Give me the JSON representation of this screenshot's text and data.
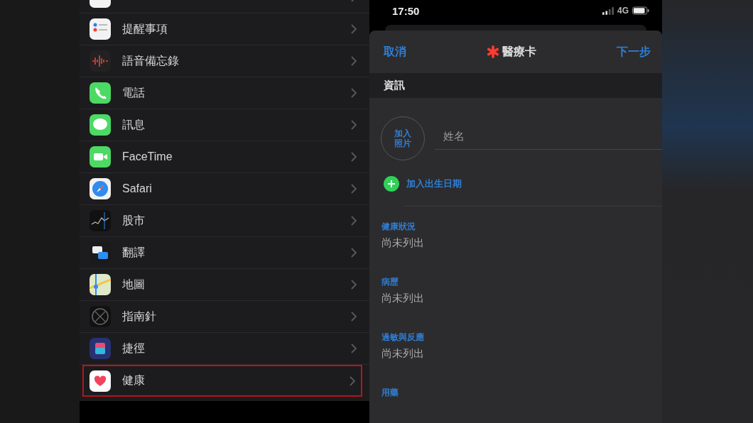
{
  "settings_list": {
    "items": [
      {
        "kind": "notes",
        "selected": false
      },
      {
        "kind": "reminders",
        "label": "提醒事項",
        "selected": false
      },
      {
        "kind": "voice-memos",
        "label": "語音備忘錄",
        "selected": false
      },
      {
        "kind": "phone",
        "label": "電話",
        "selected": false
      },
      {
        "kind": "messages",
        "label": "訊息",
        "selected": false
      },
      {
        "kind": "facetime",
        "label": "FaceTime",
        "selected": false
      },
      {
        "kind": "safari",
        "label": "Safari",
        "selected": false
      },
      {
        "kind": "stocks",
        "label": "股市",
        "selected": false
      },
      {
        "kind": "translate",
        "label": "翻譯",
        "selected": false
      },
      {
        "kind": "maps",
        "label": "地圖",
        "selected": false
      },
      {
        "kind": "compass",
        "label": "指南針",
        "selected": false
      },
      {
        "kind": "shortcuts",
        "label": "捷徑",
        "selected": false
      },
      {
        "kind": "health",
        "label": "健康",
        "selected": true
      }
    ]
  },
  "status_bar": {
    "time": "17:50",
    "network": "4G"
  },
  "medical_id": {
    "cancel": "取消",
    "title": "醫療卡",
    "next": "下一步",
    "section": "資訊",
    "photo": "加入照片",
    "name_placeholder": "姓名",
    "add_birthday": "加入出生日期",
    "fields": [
      {
        "label": "健康狀況",
        "value": "尚未列出"
      },
      {
        "label": "病歷",
        "value": "尚未列出"
      },
      {
        "label": "過敏與反應",
        "value": "尚未列出"
      },
      {
        "label": "用藥"
      }
    ]
  }
}
